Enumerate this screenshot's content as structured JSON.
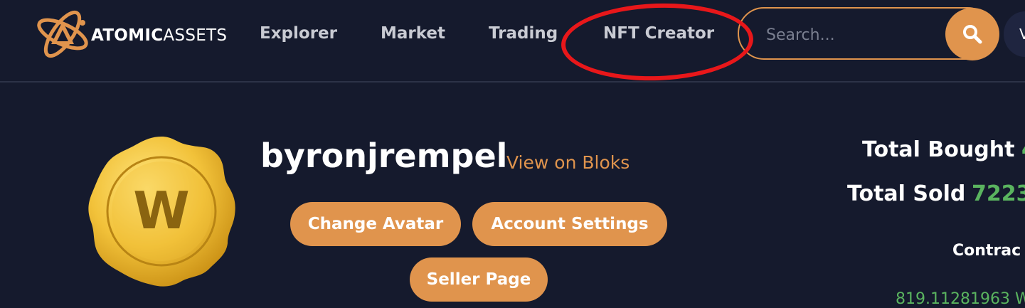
{
  "header": {
    "logo": {
      "bold": "ATOMIC",
      "light": "ASSETS"
    },
    "nav": [
      "Explorer",
      "Market",
      "Trading",
      "NFT Creator"
    ],
    "search": {
      "placeholder": "Search...",
      "value": ""
    },
    "user_initial": "V"
  },
  "profile": {
    "username": "byronjrempel",
    "bloks_link": "View on Bloks",
    "avatar_letter": "W",
    "buttons": {
      "change_avatar": "Change Avatar",
      "account_settings": "Account Settings",
      "seller_page": "Seller Page"
    }
  },
  "stats": {
    "total_bought_label": "Total Bought",
    "total_bought_value": "4",
    "total_sold_label": "Total Sold",
    "total_sold_value": "7223",
    "contract_label": "Contrac",
    "contract_value": "819.11281963 W"
  },
  "colors": {
    "background": "#151a2d",
    "accent": "#e0944d",
    "positive": "#5ab45f",
    "annotation": "#e8171a"
  }
}
